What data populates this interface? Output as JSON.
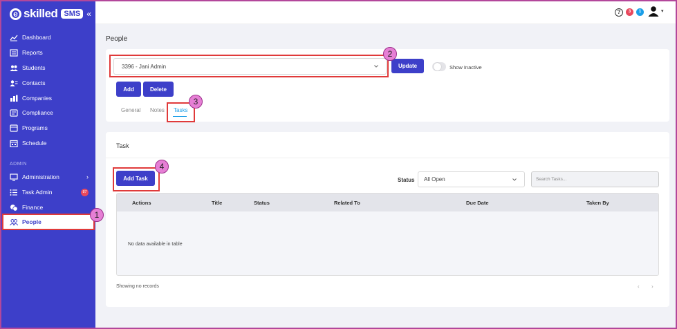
{
  "sidebar": {
    "logo_text": "skilled",
    "logo_badge": "SMS",
    "items": [
      {
        "label": "Dashboard"
      },
      {
        "label": "Reports"
      },
      {
        "label": "Students"
      },
      {
        "label": "Contacts"
      },
      {
        "label": "Companies"
      },
      {
        "label": "Compliance"
      },
      {
        "label": "Programs"
      },
      {
        "label": "Schedule"
      }
    ],
    "section_admin": "ADMIN",
    "admin_items": [
      {
        "label": "Administration"
      },
      {
        "label": "Task Admin",
        "badge": "87"
      },
      {
        "label": "Finance"
      },
      {
        "label": "People"
      }
    ]
  },
  "topbar": {
    "notif_red": "3",
    "notif_blue": "1"
  },
  "page": {
    "title": "People",
    "person_select": "3396 - Jani Admin",
    "update_label": "Update",
    "show_inactive_label": "Show Inactive",
    "add_label": "Add",
    "delete_label": "Delete",
    "tabs": [
      {
        "label": "General"
      },
      {
        "label": "Notes"
      },
      {
        "label": "Tasks"
      }
    ]
  },
  "task": {
    "section_title": "Task",
    "add_task_label": "Add Task",
    "status_label": "Status",
    "status_value": "All Open",
    "search_placeholder": "Search Tasks...",
    "columns": [
      "Actions",
      "Title",
      "Status",
      "Related To",
      "Due Date",
      "Taken By"
    ],
    "empty_text": "No data available in table",
    "records_info": "Showing no records",
    "prev": "‹",
    "next": "›"
  },
  "callouts": [
    "1",
    "2",
    "3",
    "4"
  ],
  "colors": {
    "sidebar": "#3d3fc9",
    "highlight": "#e03a3a",
    "callout": "#e67fd5",
    "active_tab": "#1a9ee8"
  }
}
